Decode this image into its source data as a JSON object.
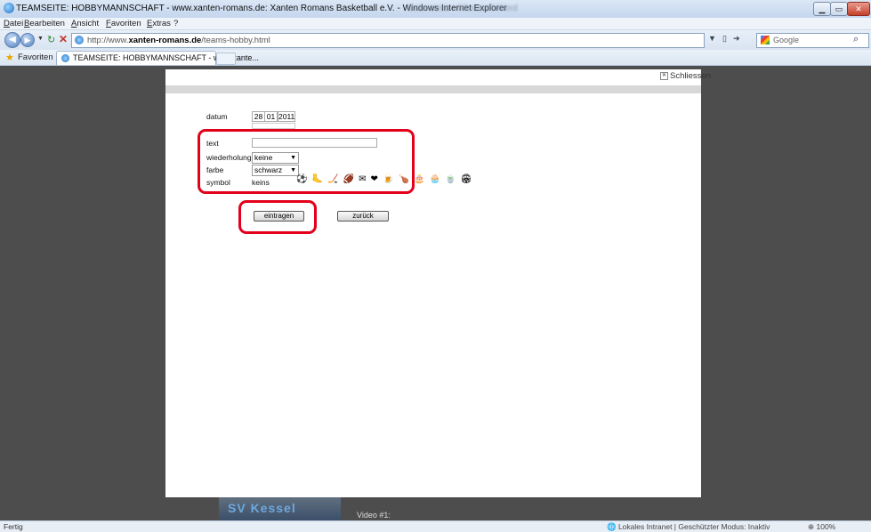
{
  "window": {
    "title": "TEAMSEITE: HOBBYMANNSCHAFT - www.xanten-romans.de: Xanten Romans Basketball e.V. - Windows Internet Explorer",
    "blurred_text": "Datenseite - Microsoft Word"
  },
  "menu": [
    "Datei",
    "Bearbeiten",
    "Ansicht",
    "Favoriten",
    "Extras",
    "?"
  ],
  "address": {
    "prefix": "http://www.",
    "domain": "xanten-romans.de",
    "path": "/teams-hobby.html"
  },
  "search": {
    "engine_label": "Google"
  },
  "favorites": {
    "label": "Favoriten"
  },
  "tab": {
    "label": "TEAMSEITE: HOBBYMANNSCHAFT - www.xante..."
  },
  "modal": {
    "close_label": "Schliessen",
    "form": {
      "datum_label": "datum",
      "day": "28",
      "month": "01",
      "year": "2011",
      "text_label": "text",
      "text_value": "",
      "wiederholung_label": "wiederholung",
      "wiederholung_value": "keine",
      "farbe_label": "farbe",
      "farbe_value": "schwarz",
      "symbol_label": "symbol",
      "symbol_value": "keins",
      "symbols": [
        "⚽",
        "🦶",
        "🏒",
        "🏈",
        "✉",
        "❤",
        "🍺",
        "🍗",
        "🎂",
        "🧁",
        "🍵",
        "🏟"
      ]
    },
    "submit_label": "eintragen",
    "back_label": "zurück"
  },
  "background": {
    "video_label": "Video #1:"
  },
  "status": {
    "left": "Fertig",
    "zone": "Lokales Intranet | Geschützter Modus: Inaktiv",
    "zoom": "100%"
  },
  "colors": {
    "highlight": "#e2001a"
  }
}
